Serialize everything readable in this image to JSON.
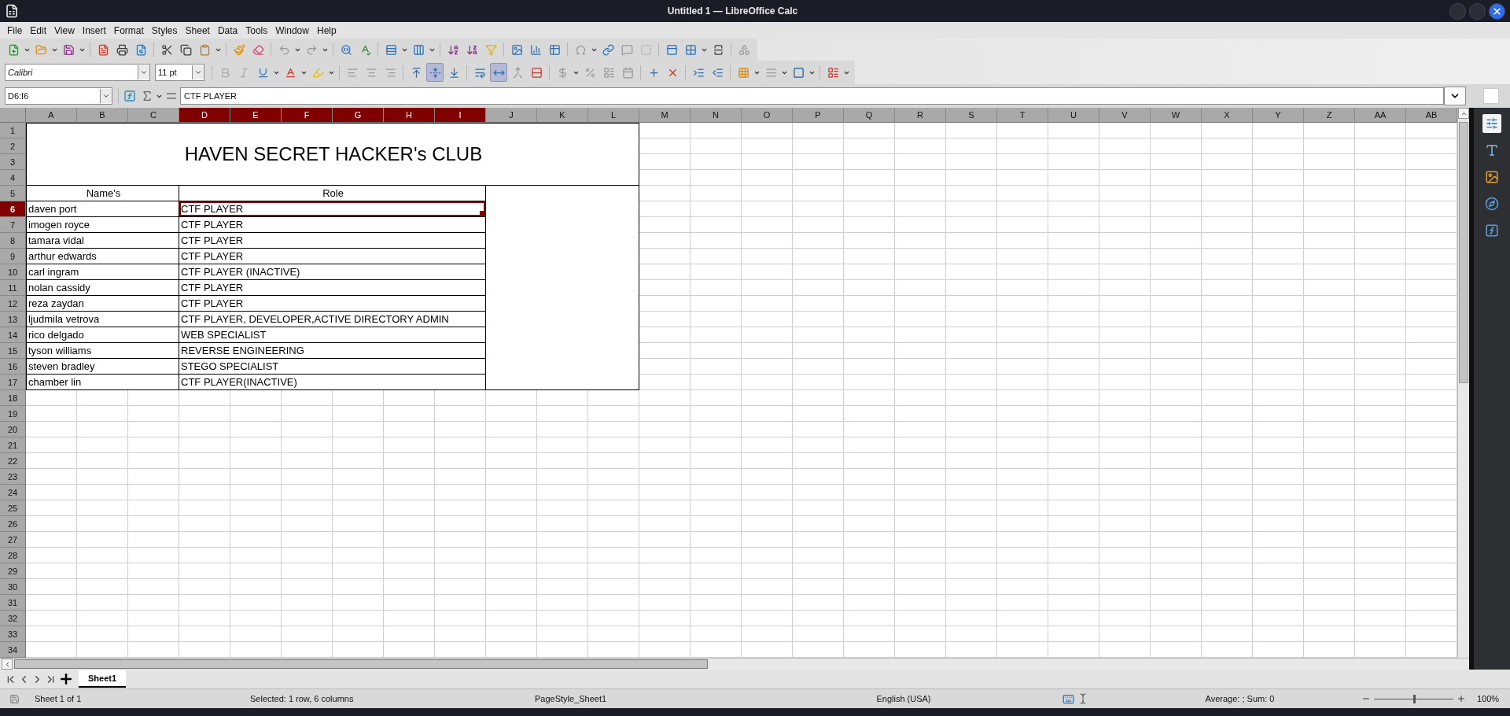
{
  "window": {
    "title": "Untitled 1 — LibreOffice Calc"
  },
  "menu": [
    "File",
    "Edit",
    "View",
    "Insert",
    "Format",
    "Styles",
    "Sheet",
    "Data",
    "Tools",
    "Window",
    "Help"
  ],
  "format_toolbar": {
    "font_name": "Calibri",
    "font_size": "11 pt",
    "center_vertically": true,
    "wrap_merge_center": true
  },
  "formula_bar": {
    "name_box": "D6:I6",
    "value": "CTF PLAYER"
  },
  "columns": [
    {
      "label": "A",
      "selected": false
    },
    {
      "label": "B",
      "selected": false
    },
    {
      "label": "C",
      "selected": false
    },
    {
      "label": "D",
      "selected": true
    },
    {
      "label": "E",
      "selected": true
    },
    {
      "label": "F",
      "selected": true
    },
    {
      "label": "G",
      "selected": true
    },
    {
      "label": "H",
      "selected": true
    },
    {
      "label": "I",
      "selected": true
    },
    {
      "label": "J",
      "selected": false
    },
    {
      "label": "K",
      "selected": false
    },
    {
      "label": "L",
      "selected": false
    },
    {
      "label": "M",
      "selected": false
    },
    {
      "label": "N",
      "selected": false
    },
    {
      "label": "O",
      "selected": false
    },
    {
      "label": "P",
      "selected": false
    },
    {
      "label": "Q",
      "selected": false
    },
    {
      "label": "R",
      "selected": false
    },
    {
      "label": "S",
      "selected": false
    },
    {
      "label": "T",
      "selected": false
    },
    {
      "label": "U",
      "selected": false
    },
    {
      "label": "V",
      "selected": false
    },
    {
      "label": "W",
      "selected": false
    },
    {
      "label": "X",
      "selected": false
    },
    {
      "label": "Y",
      "selected": false
    },
    {
      "label": "Z",
      "selected": false
    },
    {
      "label": "AA",
      "selected": false
    },
    {
      "label": "AB",
      "selected": false
    }
  ],
  "row_headers": [
    {
      "label": "1",
      "selected": false
    },
    {
      "label": "2",
      "selected": false
    },
    {
      "label": "3",
      "selected": false
    },
    {
      "label": "4",
      "selected": false
    },
    {
      "label": "5",
      "selected": false
    },
    {
      "label": "6",
      "selected": true
    },
    {
      "label": "7",
      "selected": false
    },
    {
      "label": "8",
      "selected": false
    },
    {
      "label": "9",
      "selected": false
    },
    {
      "label": "10",
      "selected": false
    },
    {
      "label": "11",
      "selected": false
    },
    {
      "label": "12",
      "selected": false
    },
    {
      "label": "13",
      "selected": false
    },
    {
      "label": "14",
      "selected": false
    },
    {
      "label": "15",
      "selected": false
    },
    {
      "label": "16",
      "selected": false
    },
    {
      "label": "17",
      "selected": false
    },
    {
      "label": "18",
      "selected": false
    },
    {
      "label": "19",
      "selected": false
    },
    {
      "label": "20",
      "selected": false
    },
    {
      "label": "21",
      "selected": false
    },
    {
      "label": "22",
      "selected": false
    },
    {
      "label": "23",
      "selected": false
    },
    {
      "label": "24",
      "selected": false
    },
    {
      "label": "25",
      "selected": false
    },
    {
      "label": "26",
      "selected": false
    },
    {
      "label": "27",
      "selected": false
    },
    {
      "label": "28",
      "selected": false
    },
    {
      "label": "29",
      "selected": false
    },
    {
      "label": "30",
      "selected": false
    },
    {
      "label": "31",
      "selected": false
    },
    {
      "label": "32",
      "selected": false
    },
    {
      "label": "33",
      "selected": false
    },
    {
      "label": "34",
      "selected": false
    }
  ],
  "sheet": {
    "title": "HAVEN SECRET HACKER's CLUB",
    "headers": [
      "Name's",
      "Role"
    ],
    "rows": [
      {
        "name": "daven port",
        "role": "CTF PLAYER",
        "selected": true
      },
      {
        "name": "imogen royce",
        "role": "CTF PLAYER",
        "selected": false
      },
      {
        "name": "tamara vidal",
        "role": "CTF PLAYER",
        "selected": false
      },
      {
        "name": "arthur edwards",
        "role": "CTF PLAYER",
        "selected": false
      },
      {
        "name": "carl ingram",
        "role": "CTF PLAYER (INACTIVE)",
        "selected": false
      },
      {
        "name": "nolan cassidy",
        "role": "CTF PLAYER",
        "selected": false
      },
      {
        "name": "reza zaydan",
        "role": "CTF PLAYER",
        "selected": false
      },
      {
        "name": "ljudmila vetrova",
        "role": "CTF PLAYER, DEVELOPER,ACTIVE DIRECTORY ADMIN",
        "selected": false
      },
      {
        "name": "rico delgado",
        "role": "WEB SPECIALIST",
        "selected": false
      },
      {
        "name": "tyson williams",
        "role": "REVERSE ENGINEERING",
        "selected": false
      },
      {
        "name": "steven bradley",
        "role": "STEGO SPECIALIST",
        "selected": false
      },
      {
        "name": "chamber lin",
        "role": "CTF PLAYER(INACTIVE)",
        "selected": false
      }
    ]
  },
  "sheet_tabs": [
    {
      "label": "Sheet1",
      "selected": true
    }
  ],
  "status_bar": {
    "sheet": "Sheet 1 of 1",
    "selection": "Selected: 1 row, 6 columns",
    "page_style": "PageStyle_Sheet1",
    "language": "English (USA)",
    "summary": "Average: ; Sum: 0",
    "zoom": "100%",
    "zoom_slider": {
      "level": 0.5
    }
  }
}
